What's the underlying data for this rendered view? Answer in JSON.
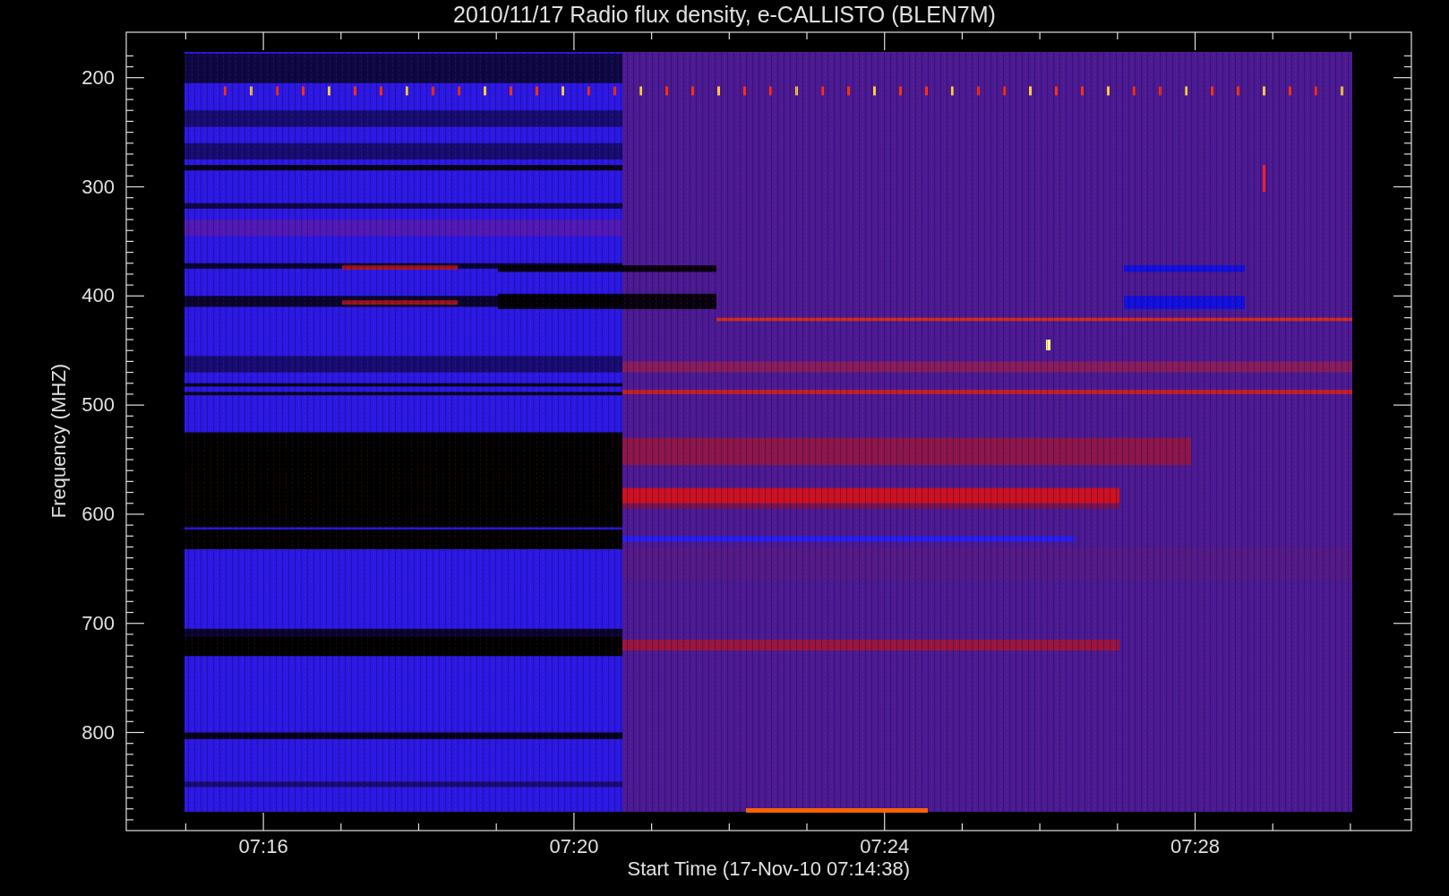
{
  "title": "2010/11/17  Radio flux density, e-CALLISTO (BLEN7M)",
  "y_axis": {
    "label": "Frequency (MHZ)",
    "ticks": [
      "200",
      "300",
      "400",
      "500",
      "600",
      "700",
      "800"
    ]
  },
  "x_axis": {
    "label": "Start Time (17-Nov-10 07:14:38)",
    "ticks": [
      "07:16",
      "07:20",
      "07:24",
      "07:28"
    ]
  }
}
